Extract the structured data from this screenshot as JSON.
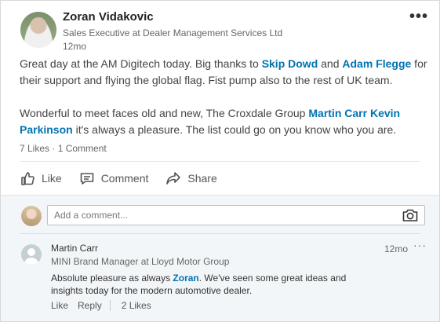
{
  "post": {
    "author_name": "Zoran Vidakovic",
    "author_title": "Sales Executive at Dealer Management Services Ltd",
    "time": "12mo",
    "more_glyph": "•••",
    "paragraph1": {
      "t1": "Great day at the AM Digitech today. Big thanks to ",
      "m1": "Skip Dowd",
      "t2": " and ",
      "m2": "Adam Flegge",
      "t3": " for their support and flying the global flag. Fist pump also to the rest of UK team."
    },
    "paragraph2": {
      "t1": "Wonderful to meet faces old and new, The Croxdale Group ",
      "m1": "Martin Carr",
      "t2": " ",
      "m2": "Kevin Parkinson",
      "t3": " it's always a pleasure. The list could go on you know who you are."
    },
    "likes": "7 Likes",
    "dot": " · ",
    "comments_count": "1 Comment"
  },
  "actions": {
    "like": "Like",
    "comment": "Comment",
    "share": "Share"
  },
  "composer": {
    "placeholder": "Add a comment..."
  },
  "comment": {
    "name": "Martin Carr",
    "title": "MINI Brand Manager at Lloyd Motor Group",
    "time": "12mo",
    "more_glyph": "···",
    "text_before": "Absolute pleasure as always ",
    "mention": "Zoran",
    "text_after": ". We've seen some great ideas and insights today for the modern automotive dealer.",
    "like": "Like",
    "reply": "Reply",
    "likes": "2 Likes"
  }
}
